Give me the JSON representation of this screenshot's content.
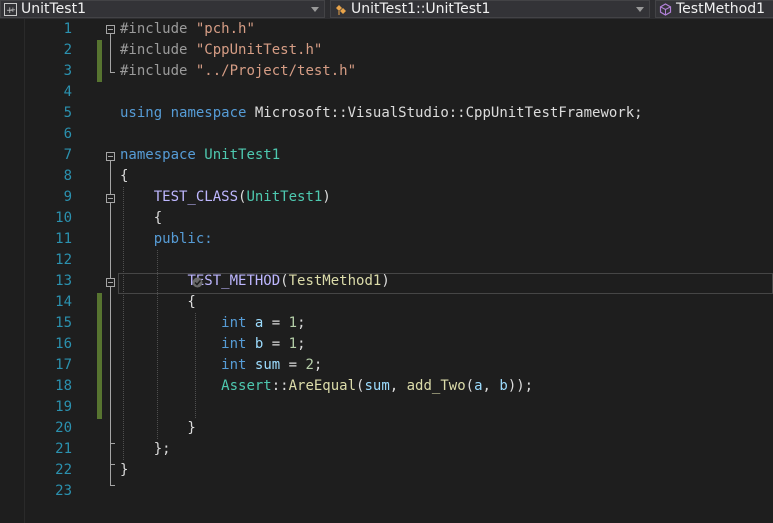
{
  "navbar": {
    "project_combo": {
      "label": "UnitTest1",
      "icon": "cpp-project-icon"
    },
    "scope_combo": {
      "label": "UnitTest1::UnitTest1",
      "icon": "class-icon"
    },
    "member_combo": {
      "label": "TestMethod1",
      "icon": "method-icon"
    }
  },
  "editor": {
    "lines": [
      {
        "number": "1",
        "text": "#include \"pch.h\""
      },
      {
        "number": "2",
        "text": "#include \"CppUnitTest.h\""
      },
      {
        "number": "3",
        "text": "#include \"../Project/test.h\""
      },
      {
        "number": "4",
        "text": ""
      },
      {
        "number": "5",
        "text": "using namespace Microsoft::VisualStudio::CppUnitTestFramework;"
      },
      {
        "number": "6",
        "text": ""
      },
      {
        "number": "7",
        "text": "namespace UnitTest1"
      },
      {
        "number": "8",
        "text": "{"
      },
      {
        "number": "9",
        "text": "    TEST_CLASS(UnitTest1)"
      },
      {
        "number": "10",
        "text": "    {"
      },
      {
        "number": "11",
        "text": "    public:"
      },
      {
        "number": "12",
        "text": ""
      },
      {
        "number": "13",
        "text": "        TEST_METHOD(TestMethod1)"
      },
      {
        "number": "14",
        "text": "        {"
      },
      {
        "number": "15",
        "text": "            int a = 1;"
      },
      {
        "number": "16",
        "text": "            int b = 1;"
      },
      {
        "number": "17",
        "text": "            int sum = 2;"
      },
      {
        "number": "18",
        "text": "            Assert::AreEqual(sum, add_Two(a, b));"
      },
      {
        "number": "19",
        "text": ""
      },
      {
        "number": "20",
        "text": "        }"
      },
      {
        "number": "21",
        "text": "    };"
      },
      {
        "number": "22",
        "text": "}"
      },
      {
        "number": "23",
        "text": ""
      }
    ],
    "current_line": "13",
    "modified_lines": [
      "2",
      "3",
      "14",
      "15",
      "16",
      "17",
      "18",
      "19"
    ]
  },
  "colors": {
    "background": "#1e1e1e",
    "line_number": "#2b91af",
    "keyword": "#569cd6",
    "string": "#d69d85",
    "type": "#4ec9b0",
    "macro": "#beb7ff",
    "function": "#dcdcaa",
    "variable": "#9cdcfe",
    "number": "#b5cea8",
    "change_marker": "#577430"
  }
}
